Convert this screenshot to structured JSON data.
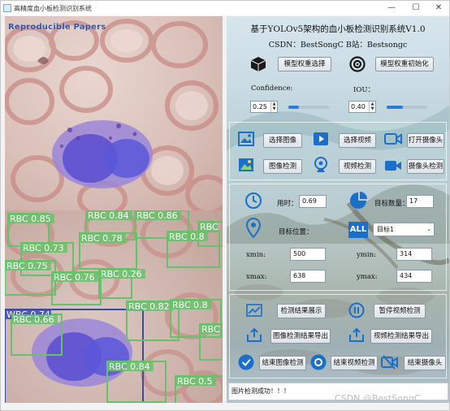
{
  "window": {
    "title": "高精度血小板检测识别系统",
    "overlay_title": "Reproducible Papers",
    "controls": {
      "minimize": "—",
      "maximize": "☐",
      "close": "✕"
    }
  },
  "header": {
    "title": "基于YOLOv5架构的血小板检测识别系统V1.0",
    "subtitle": "CSDN：BestSongC   B站：Bestsongc"
  },
  "model": {
    "select_button": "模型权重选择",
    "init_button": "模型权重初始化",
    "confidence_label": "Confidence:",
    "confidence_value": "0.25",
    "confidence_level": 0.25,
    "iou_label": "IOU：",
    "iou_value": "0.40",
    "iou_level": 0.4
  },
  "actions": {
    "select_image": "选择图像",
    "select_video": "选择视频",
    "open_camera": "打开摄像头",
    "image_detect": "图像检测",
    "video_detect": "视频检测",
    "camera_detect": "摄像头检测"
  },
  "results": {
    "time_label": "用时：",
    "time_value": "0.69",
    "count_label": "目标数量：",
    "count_value": "17",
    "position_label": "目标位置：",
    "target_label": "目标1",
    "xmin_label": "xmin:",
    "xmin_value": "500",
    "ymin_label": "ymin:",
    "ymin_value": "314",
    "xmax_label": "xmax:",
    "xmax_value": "638",
    "ymax_label": "ymax:",
    "ymax_value": "434"
  },
  "bottom": {
    "show_results": "检测结果展示",
    "pause_video": "暂停视频检测",
    "export_image": "图像检测结果导出",
    "export_video": "视频检测结果导出",
    "end_image": "结束图像检测",
    "end_video": "结束视频检测",
    "end_camera": "结束摄像头"
  },
  "status_text": "图片检测成功！！！",
  "watermark": "CSDN @BestSongC",
  "detections": [
    {
      "label": "RBC 0.85",
      "color": "#66c26a"
    },
    {
      "label": "RBC 0.84",
      "color": "#66c26a"
    },
    {
      "label": "RBC 0.86",
      "color": "#66c26a"
    },
    {
      "label": "RBC",
      "color": "#66c26a"
    },
    {
      "label": "RBC 0.73",
      "color": "#66c26a"
    },
    {
      "label": "RBC 0.78",
      "color": "#66c26a"
    },
    {
      "label": "RBC 0.8",
      "color": "#66c26a"
    },
    {
      "label": "RBC 0.75",
      "color": "#66c26a"
    },
    {
      "label": "RBC 0.76",
      "color": "#66c26a"
    },
    {
      "label": "RBC 0.26",
      "color": "#66c26a"
    },
    {
      "label": "WBC 0.74",
      "color": "#3a4aa8"
    },
    {
      "label": "RBC 0.66",
      "color": "#66c26a"
    },
    {
      "label": "RBC 0.82",
      "color": "#66c26a"
    },
    {
      "label": "RBC 0.8",
      "color": "#66c26a"
    },
    {
      "label": "RBC",
      "color": "#66c26a"
    },
    {
      "label": "RBC 0.84",
      "color": "#66c26a"
    },
    {
      "label": "RBC 0.5",
      "color": "#66c26a"
    }
  ],
  "colors": {
    "rbc_box": "#66c26a",
    "wbc_box": "#3a4aa8",
    "accent_blue": "#2c7bd6"
  }
}
